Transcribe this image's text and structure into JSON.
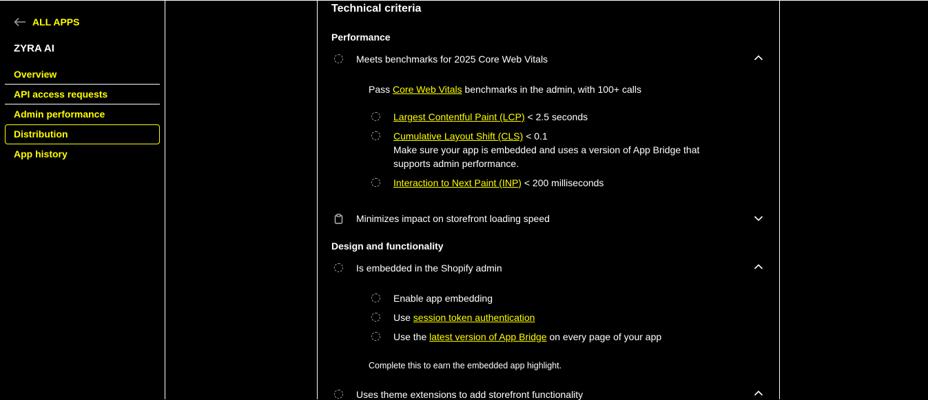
{
  "sidebar": {
    "back_label": "ALL APPS",
    "app_name": "ZYRA AI",
    "items": [
      {
        "label": "Overview"
      },
      {
        "label": "API access requests"
      },
      {
        "label": "Admin performance"
      },
      {
        "label": "Distribution"
      },
      {
        "label": "App history"
      }
    ]
  },
  "main": {
    "title": "Technical criteria",
    "performance": {
      "heading": "Performance",
      "item1": {
        "label": "Meets benchmarks for 2025 Core Web Vitals",
        "desc_pre": "Pass",
        "desc_link": "Core Web Vitals",
        "desc_post": "benchmarks in the admin, with 100+ calls",
        "lcp_link": "Largest Contentful Paint (LCP)",
        "lcp_value": "< 2.5 seconds",
        "cls_link": "Cumulative Layout Shift (CLS)",
        "cls_value": "< 0.1",
        "cls_note_1": "Make sure your app is embedded and uses a version of App Bridge that",
        "cls_note_2": "supports admin performance.",
        "inp_link": "Interaction to Next Paint (INP)",
        "inp_value": "< 200 milliseconds"
      },
      "item2": {
        "label": "Minimizes impact on storefront loading speed"
      }
    },
    "design": {
      "heading": "Design and functionality",
      "item1": {
        "label": "Is embedded in the Shopify admin",
        "sub1": "Enable app embedding",
        "sub2_pre": "Use",
        "sub2_link": "session token authentication",
        "sub3_pre": "Use the",
        "sub3_link": "latest version of App Bridge",
        "sub3_post": "on every page of your app",
        "note": "Complete this to earn the embedded app highlight."
      },
      "item2": {
        "label": "Uses theme extensions to add storefront functionality"
      }
    }
  },
  "icons": {
    "status": "dashed-circle-icon",
    "clipboard": "clipboard-icon",
    "expand": "chevron-down-icon",
    "collapse": "chevron-up-icon"
  },
  "colors": {
    "accent": "#ffff00",
    "background": "#000000",
    "text": "#ffffff"
  }
}
